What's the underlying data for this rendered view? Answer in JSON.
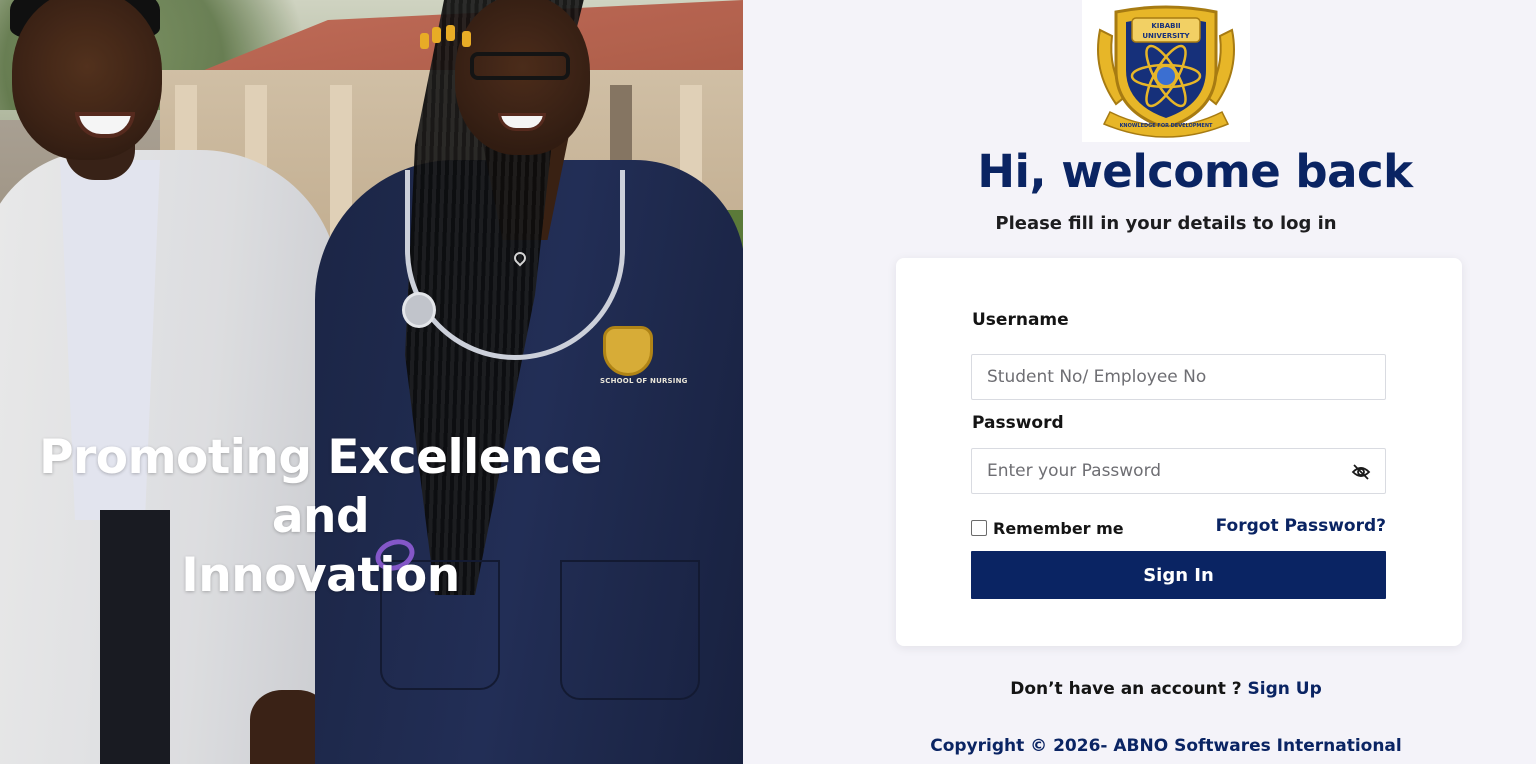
{
  "hero": {
    "title_line1": "Promoting Excellence and",
    "title_line2": "Innovation",
    "badge_text": "SCHOOL OF NURSING"
  },
  "logo": {
    "top_text": "KIBABII",
    "middle_text": "UNIVERSITY",
    "motto": "KNOWLEDGE FOR DEVELOPMENT",
    "colors": {
      "gold": "#e7b628",
      "navy": "#16307a"
    }
  },
  "header": {
    "title": "Hi, welcome back",
    "subtitle": "Please fill in your details to log in"
  },
  "form": {
    "username_label": "Username",
    "username_placeholder": "Student No/ Employee No",
    "username_value": "",
    "password_label": "Password",
    "password_placeholder": "Enter your Password",
    "password_value": "",
    "password_toggle_icon": "eye-off-icon",
    "remember_label": "Remember me",
    "remember_checked": false,
    "forgot_label": "Forgot Password?",
    "submit_label": "Sign In"
  },
  "footer": {
    "signup_prompt": "Don’t have an account ?",
    "signup_link": "Sign Up",
    "copyright": "Copyright © 2026- ABNO Softwares International"
  },
  "colors": {
    "primary": "#0a2463",
    "background": "#f4f3f9",
    "card": "#ffffff"
  }
}
